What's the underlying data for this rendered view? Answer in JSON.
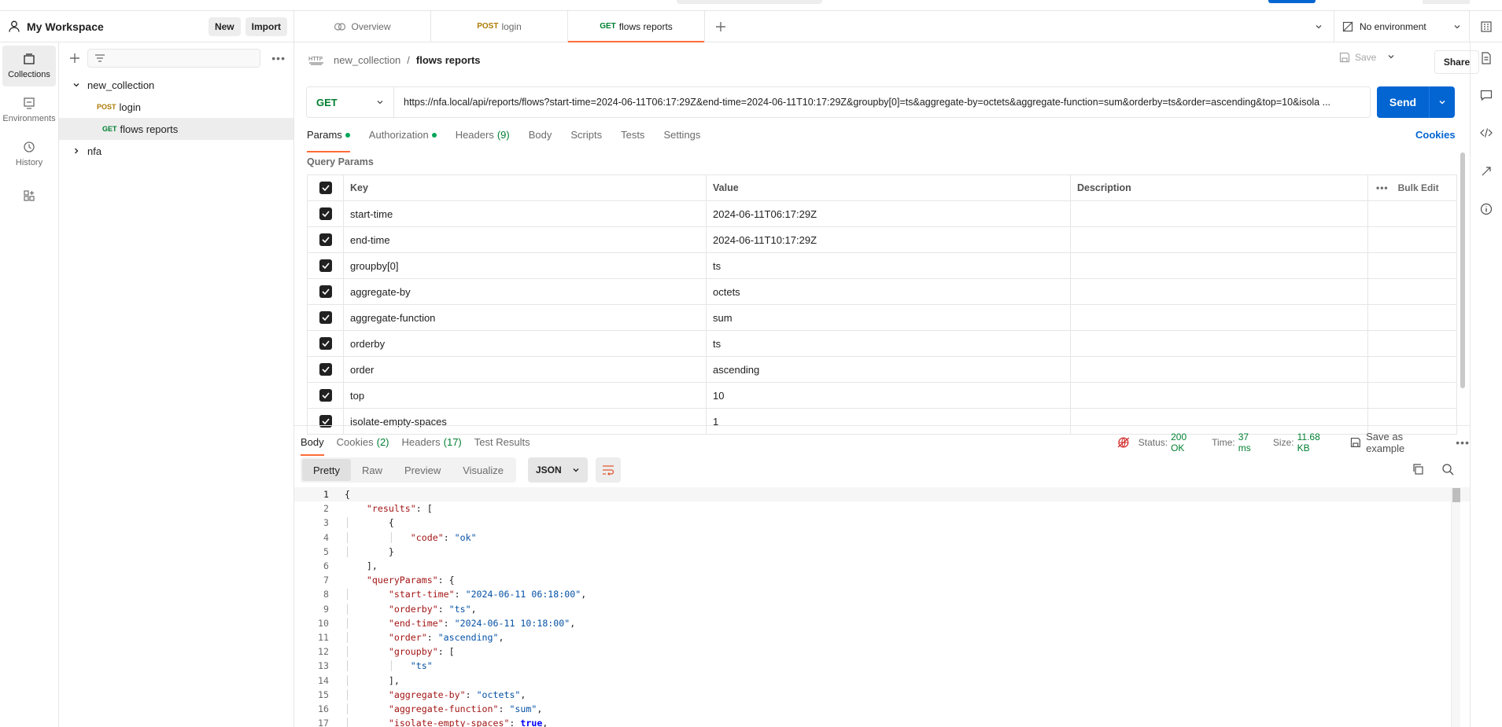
{
  "workspace": {
    "title": "My Workspace",
    "new_label": "New",
    "import_label": "Import"
  },
  "rail": [
    {
      "label": "Collections",
      "icon": "collections-icon",
      "active": true
    },
    {
      "label": "Environments",
      "icon": "environments-icon",
      "active": false
    },
    {
      "label": "History",
      "icon": "history-icon",
      "active": false
    },
    {
      "label": "",
      "icon": "apps-icon",
      "active": false
    }
  ],
  "sidebar": {
    "search_placeholder": "",
    "tree": {
      "collection": "new_collection",
      "requests": [
        {
          "method": "POST",
          "name": "login"
        },
        {
          "method": "GET",
          "name": "flows reports"
        }
      ],
      "folder": "nfa"
    }
  },
  "tabs": [
    {
      "label": "Overview",
      "method": ""
    },
    {
      "label": "login",
      "method": "POST"
    },
    {
      "label": "flows reports",
      "method": "GET"
    }
  ],
  "environment": {
    "label": "No environment"
  },
  "breadcrumb": {
    "collection": "new_collection",
    "separator": "/",
    "request": "flows reports"
  },
  "toolbar": {
    "save_label": "Save",
    "share_label": "Share"
  },
  "request": {
    "method": "GET",
    "url": "https://nfa.local/api/reports/flows?start-time=2024-06-11T06:17:29Z&end-time=2024-06-11T10:17:29Z&groupby[0]=ts&aggregate-by=octets&aggregate-function=sum&orderby=ts&order=ascending&top=10&isola ...",
    "send_label": "Send"
  },
  "request_tabs": {
    "params": "Params",
    "authorization": "Authorization",
    "headers": "Headers",
    "headers_count": "(9)",
    "body": "Body",
    "scripts": "Scripts",
    "tests": "Tests",
    "settings": "Settings",
    "cookies": "Cookies"
  },
  "query_params": {
    "title": "Query Params",
    "headers": {
      "key": "Key",
      "value": "Value",
      "description": "Description",
      "bulk_edit": "Bulk Edit"
    },
    "rows": [
      {
        "key": "start-time",
        "value": "2024-06-11T06:17:29Z"
      },
      {
        "key": "end-time",
        "value": "2024-06-11T10:17:29Z"
      },
      {
        "key": "groupby[0]",
        "value": "ts"
      },
      {
        "key": "aggregate-by",
        "value": "octets"
      },
      {
        "key": "aggregate-function",
        "value": "sum"
      },
      {
        "key": "orderby",
        "value": "ts"
      },
      {
        "key": "order",
        "value": "ascending"
      },
      {
        "key": "top",
        "value": "10"
      },
      {
        "key": "isolate-empty-spaces",
        "value": "1"
      }
    ]
  },
  "response": {
    "tabs": {
      "body": "Body",
      "cookies": "Cookies",
      "cookies_count": "(2)",
      "headers": "Headers",
      "headers_count": "(17)",
      "test_results": "Test Results"
    },
    "status_label": "Status:",
    "status_value": "200 OK",
    "time_label": "Time:",
    "time_value": "37 ms",
    "size_label": "Size:",
    "size_value": "11.68 KB",
    "save_example": "Save as example",
    "views": [
      "Pretty",
      "Raw",
      "Preview",
      "Visualize"
    ],
    "format": "JSON"
  },
  "code_lines": [
    "1",
    "2",
    "3",
    "4",
    "5",
    "6",
    "7",
    "8",
    "9",
    "10",
    "11",
    "12",
    "13",
    "14",
    "15",
    "16",
    "17"
  ],
  "json": {
    "results_key": "\"results\"",
    "code_key": "\"code\"",
    "code_val": "\"ok\"",
    "qp_key": "\"queryParams\"",
    "st_key": "\"start-time\"",
    "st_val": "\"2024-06-11 06:18:00\"",
    "ob_key": "\"orderby\"",
    "ob_val": "\"ts\"",
    "et_key": "\"end-time\"",
    "et_val": "\"2024-06-11 10:18:00\"",
    "or_key": "\"order\"",
    "or_val": "\"ascending\"",
    "gb_key": "\"groupby\"",
    "gb_val": "\"ts\"",
    "ab_key": "\"aggregate-by\"",
    "ab_val": "\"octets\"",
    "af_key": "\"aggregate-function\"",
    "af_val": "\"sum\"",
    "ie_key": "\"isolate-empty-spaces\"",
    "ie_val": "true"
  }
}
